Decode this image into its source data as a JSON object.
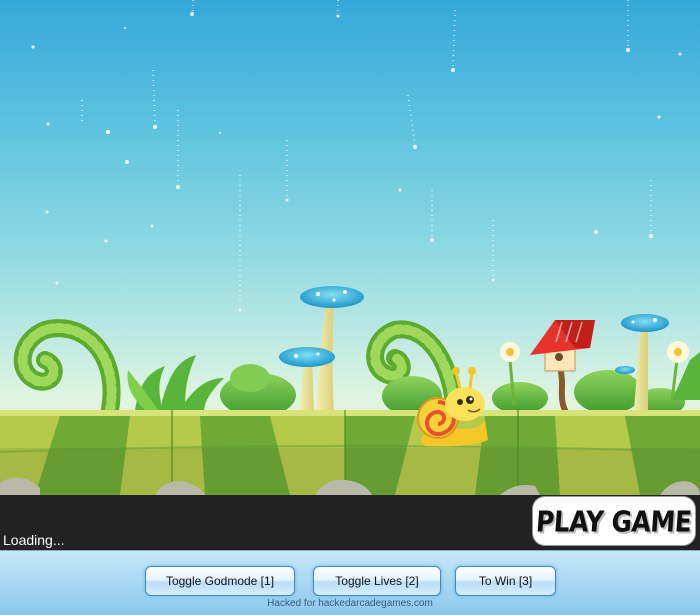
{
  "game": {
    "play_label": "PLAY GAME",
    "loading_text": "Loading..."
  },
  "cheats": {
    "buttons": [
      {
        "label": "Toggle Godmode [1]"
      },
      {
        "label": "Toggle Lives [2]"
      },
      {
        "label": "To Win [3]"
      }
    ],
    "credit": "Hacked for hackedarcadegames.com"
  },
  "colors": {
    "sky_top": "#35a8da",
    "sky_bottom": "#e9f6df",
    "ground_light": "#b5c94a",
    "ground_dark": "#5d9b2f",
    "loading_bar": "#222222",
    "panel": "#a6d6f2"
  }
}
